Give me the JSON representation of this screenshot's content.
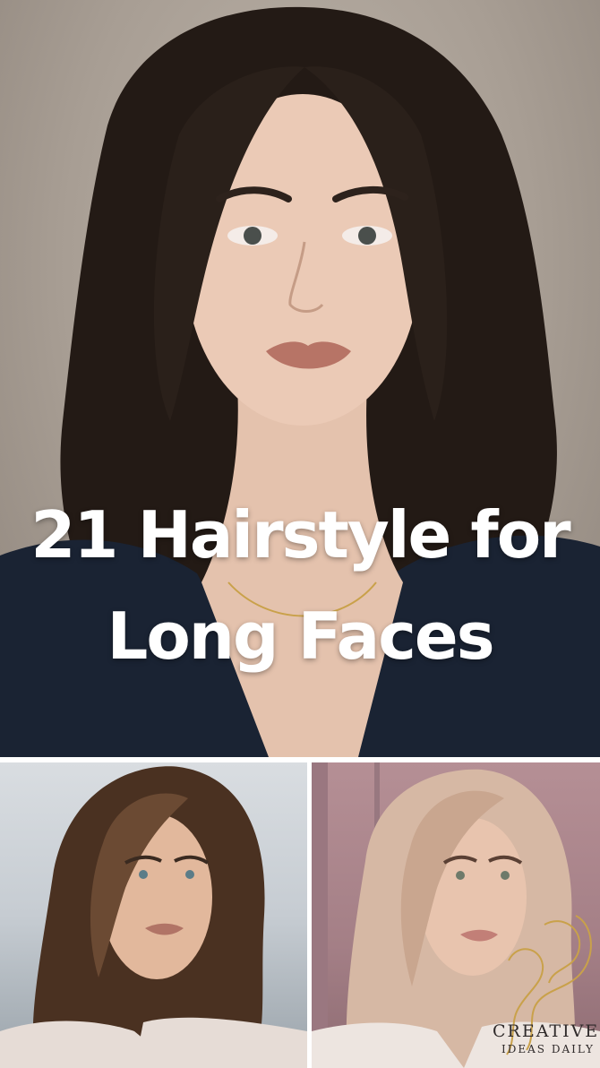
{
  "headline": {
    "line1": "21 Hairstyle for",
    "line2": "Long Faces"
  },
  "watermark": {
    "line1": "CREATIVE",
    "line2": "IDEAS DAILY"
  },
  "colors": {
    "headline_text": "#ffffff",
    "hair_dark": "#1e1713",
    "jacket": "#1a2333",
    "watermark_gold": "#c9a14a"
  }
}
